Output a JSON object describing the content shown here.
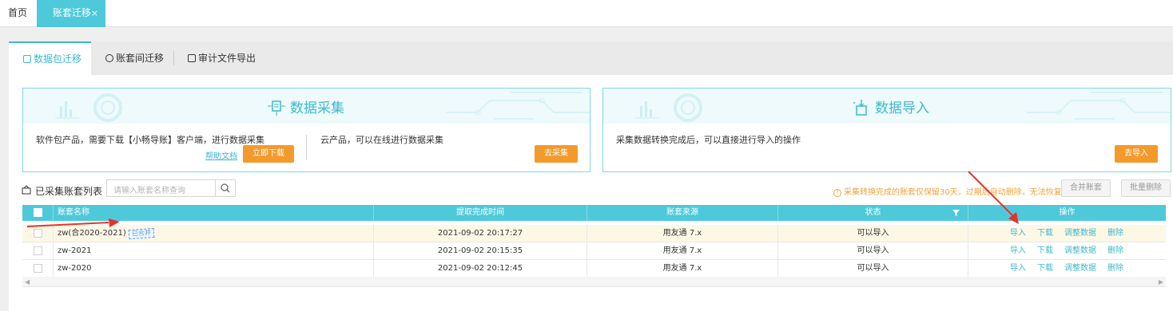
{
  "topbar": {
    "home": "首页",
    "active_tab": "账套迁移",
    "close": "×"
  },
  "subtabs": [
    {
      "label": "数据包迁移"
    },
    {
      "label": "账套间迁移"
    },
    {
      "label": "审计文件导出"
    }
  ],
  "card_collect": {
    "title": "数据采集",
    "desc_software": "软件包产品，需要下载【小畅导账】客户端，进行数据采集",
    "help_link": "帮助文档",
    "download_btn": "立即下载",
    "desc_cloud": "云产品，可以在线进行数据采集",
    "collect_btn": "去采集"
  },
  "card_import": {
    "title": "数据导入",
    "desc": "采集数据转换完成后，可以直接进行导入的操作",
    "import_btn": "去导入"
  },
  "list": {
    "title": "已采集账套列表",
    "search_placeholder": "请输入账套名称查询",
    "notice": "采集转换完成的账套仅保留30天，过期后自动删除，无法恢复",
    "merge_btn": "合并账套",
    "batch_delete_btn": "批量删除"
  },
  "table": {
    "headers": {
      "name": "账套名称",
      "time": "提取完成时间",
      "source": "账套来源",
      "status": "状态",
      "ops": "操作"
    },
    "rows": [
      {
        "name": "zw(合2020-2021)",
        "badge": "已合并",
        "time": "2021-09-02 20:17:27",
        "source": "用友通 7.x",
        "status": "可以导入"
      },
      {
        "name": "zw-2021",
        "badge": "",
        "time": "2021-09-02 20:15:35",
        "source": "用友通 7.x",
        "status": "可以导入"
      },
      {
        "name": "zw-2020",
        "badge": "",
        "time": "2021-09-02 20:12:45",
        "source": "用友通 7.x",
        "status": "可以导入"
      }
    ],
    "ops": {
      "import": "导入",
      "download": "下载",
      "adjust": "调整数据",
      "delete": "删除"
    }
  },
  "colors": {
    "accent": "#4ec9d9",
    "orange": "#f39a2c",
    "annotation": "#e8322b"
  }
}
